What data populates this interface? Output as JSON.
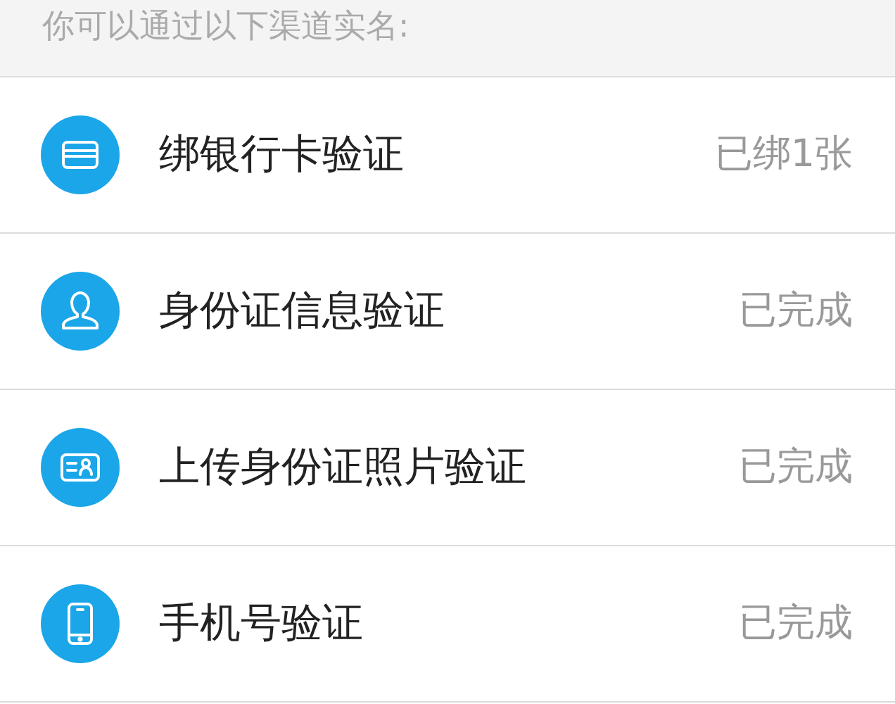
{
  "header": {
    "text": "你可以通过以下渠道实名:"
  },
  "items": [
    {
      "kind": "card",
      "label": "绑银行卡验证",
      "status": "已绑1张"
    },
    {
      "kind": "person",
      "label": "身份证信息验证",
      "status": "已完成"
    },
    {
      "kind": "idcard",
      "label": "上传身份证照片验证",
      "status": "已完成"
    },
    {
      "kind": "phone",
      "label": "手机号验证",
      "status": "已完成"
    }
  ]
}
